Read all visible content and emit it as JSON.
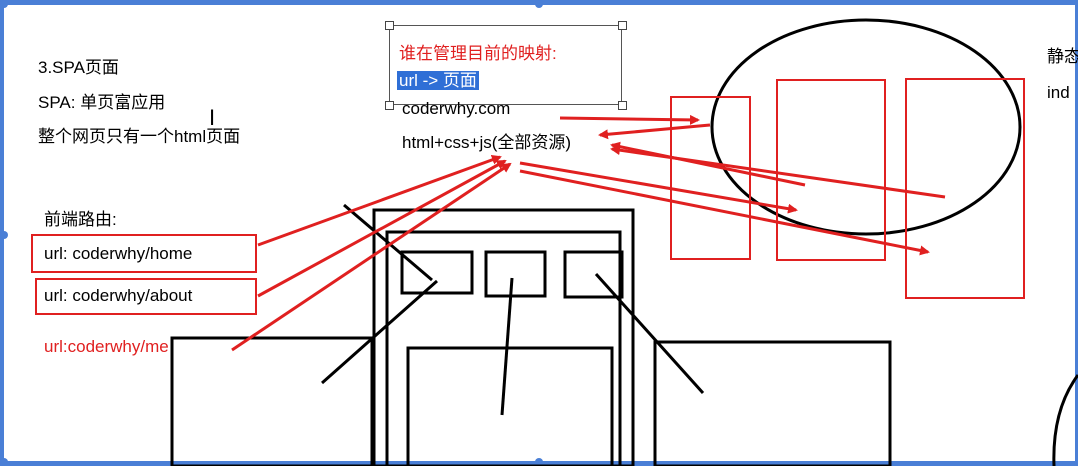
{
  "notes": {
    "line1": "3.SPA页面",
    "line2": "SPA: 单页富应用",
    "line3": "整个网页只有一个html页面",
    "router_title": "前端路由:",
    "url_home": "url: coderwhy/home",
    "url_about": "url: coderwhy/about",
    "url_me": "url:coderwhy/me"
  },
  "mapping": {
    "question": "谁在管理目前的映射:",
    "selected": "url -> 页面",
    "domain": "coderwhy.com",
    "resources": "html+css+js(全部资源)"
  },
  "right_edge": {
    "top": "静态",
    "bottom": "ind"
  },
  "colors": {
    "accent_red": "#e02020",
    "selection_blue": "#2f6fd6",
    "frame_blue": "#4a7fd6"
  }
}
